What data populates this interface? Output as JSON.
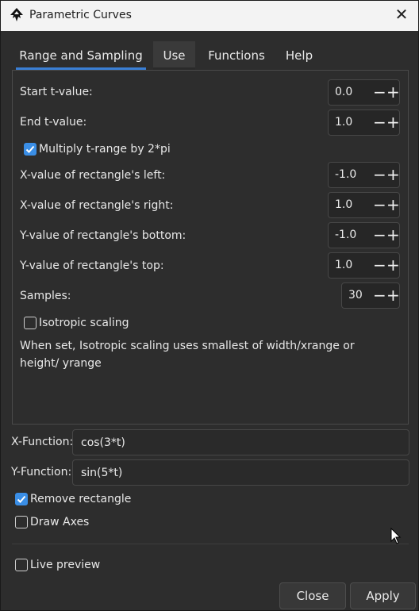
{
  "window": {
    "title": "Parametric Curves",
    "app_icon": "inkscape-logo-icon",
    "close_glyph": "✕"
  },
  "tabs": [
    {
      "label": "Range and Sampling",
      "active": true
    },
    {
      "label": "Use",
      "active": false
    },
    {
      "label": "Functions",
      "active": false
    },
    {
      "label": "Help",
      "active": false
    }
  ],
  "range": {
    "start": {
      "label": "Start t-value:",
      "value": "0.0"
    },
    "end": {
      "label": "End t-value:",
      "value": "1.0"
    },
    "multiply": {
      "label": "Multiply t-range by 2*pi",
      "checked": true
    },
    "x_left": {
      "label": "X-value of rectangle's left:",
      "value": "-1.0"
    },
    "x_right": {
      "label": "X-value of rectangle's right:",
      "value": "1.0"
    },
    "y_bottom": {
      "label": "Y-value of rectangle's bottom:",
      "value": "-1.0"
    },
    "y_top": {
      "label": "Y-value of rectangle's top:",
      "value": "1.0"
    },
    "samples": {
      "label": "Samples:",
      "value": "30"
    },
    "isotropic": {
      "label": "Isotropic scaling",
      "checked": false
    },
    "note": "When set, Isotropic scaling uses smallest of width/xrange or height/ yrange"
  },
  "stepper": {
    "minus": "−",
    "plus": "+"
  },
  "functions": {
    "x": {
      "label": "X-Function:",
      "value": "cos(3*t)"
    },
    "y": {
      "label": "Y-Function:",
      "value": "sin(5*t)"
    }
  },
  "options": {
    "remove_rectangle": {
      "label": "Remove rectangle",
      "checked": true
    },
    "draw_axes": {
      "label": "Draw Axes",
      "checked": false
    },
    "live_preview": {
      "label": "Live preview",
      "checked": false
    }
  },
  "buttons": {
    "close": "Close",
    "apply": "Apply"
  },
  "colors": {
    "accent": "#3a8ee6",
    "window_bg": "#2d2d2d",
    "titlebar_bg": "#f3f3f3"
  }
}
